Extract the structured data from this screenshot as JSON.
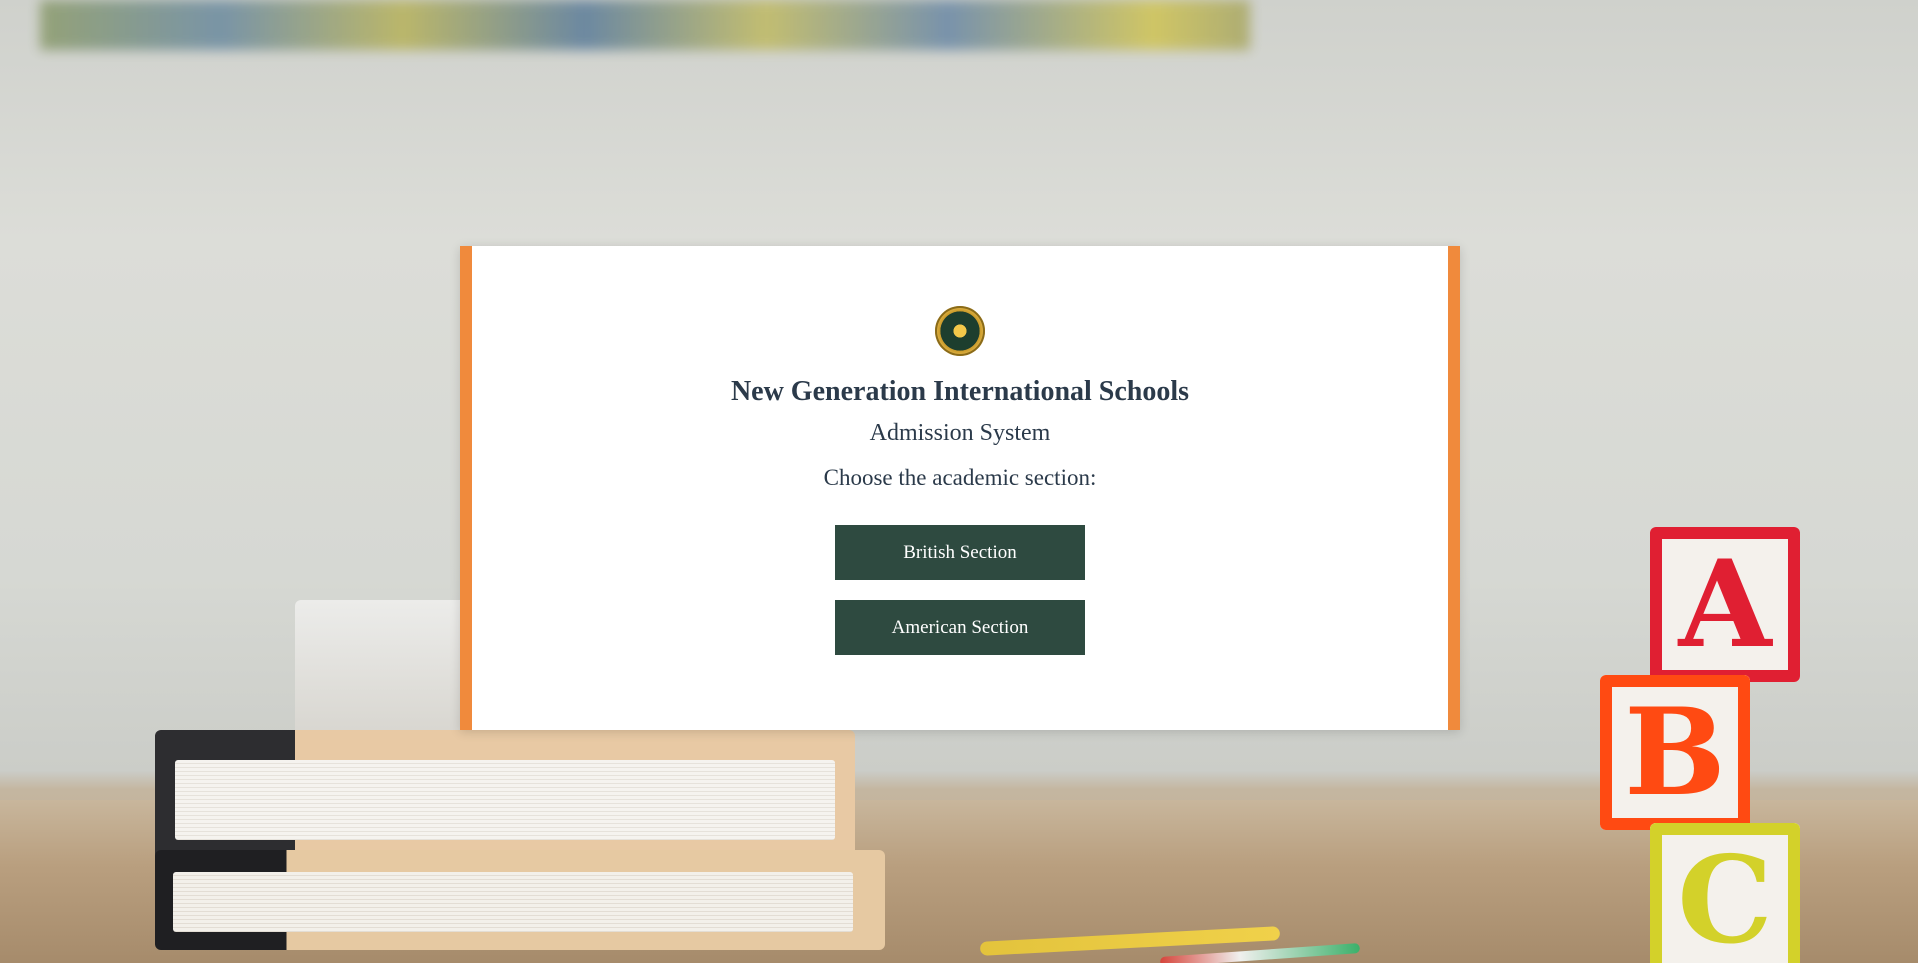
{
  "card": {
    "title": "New Generation International Schools",
    "subtitle": "Admission System",
    "prompt": "Choose the academic section:",
    "buttons": [
      {
        "label": "British Section"
      },
      {
        "label": "American Section"
      }
    ]
  },
  "background": {
    "blocks": [
      "A",
      "B",
      "C"
    ]
  },
  "colors": {
    "accent": "#f08a3c",
    "button": "#2e4a40",
    "text": "#2b3a4a"
  },
  "icons": {
    "logo": "school-crest-icon"
  }
}
